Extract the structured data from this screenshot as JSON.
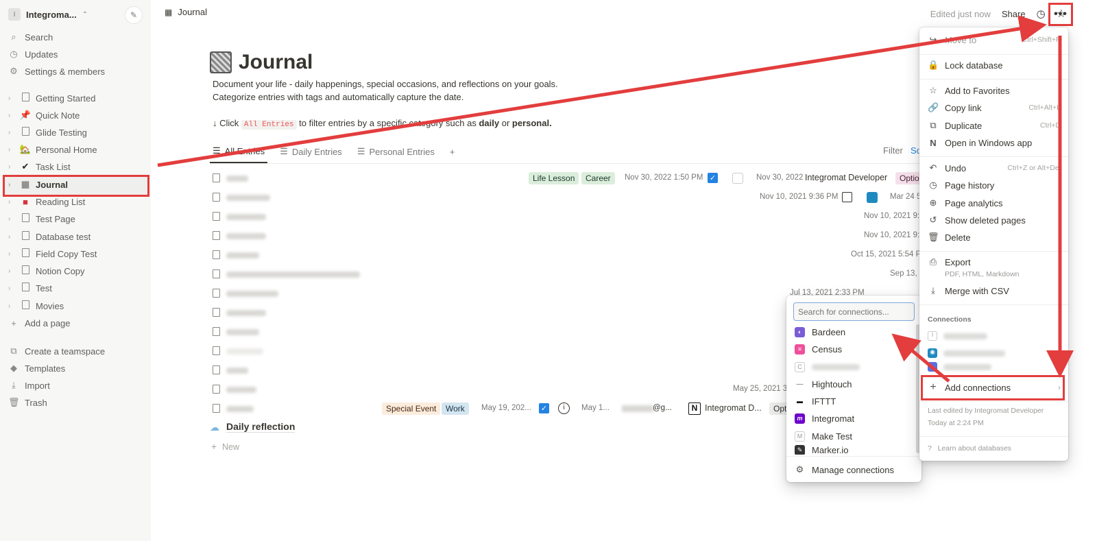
{
  "sidebar": {
    "workspace": "Integroma...",
    "workspace_initial": "I",
    "top": [
      "Search",
      "Updates",
      "Settings & members"
    ],
    "pages": [
      "Getting Started",
      "Quick Note",
      "Glide Testing",
      "Personal Home",
      "Task List",
      "Journal",
      "Reading List",
      "Test Page",
      "Database test",
      "Field Copy Test",
      "Notion Copy",
      "Test",
      "Movies"
    ],
    "add_page": "Add a page",
    "bottom": [
      "Create a teamspace",
      "Templates",
      "Import",
      "Trash"
    ]
  },
  "topbar": {
    "breadcrumb": "Journal",
    "edited": "Edited just now",
    "share": "Share"
  },
  "page": {
    "title": "Journal",
    "desc1": "Document your life - daily happenings, special occasions, and reflections on your goals.",
    "desc2": "Categorize entries with tags and automatically capture the date.",
    "tip_pre": "↓ Click",
    "tip_code": "All Entries",
    "tip_mid": "to filter entries by a specific category such as",
    "tip_b1": "daily",
    "tip_or": "or",
    "tip_b2": "personal.",
    "tabs": [
      "All Entries",
      "Daily Entries",
      "Personal Entries"
    ],
    "filter": "Filter",
    "sort": "So",
    "rows": {
      "r1": {
        "tag1": "Life Lesson",
        "tag2": "Career",
        "created": "Nov 30, 2022 1:50 PM",
        "date": "Nov 30, 2022",
        "person": "Integromat Developer",
        "opt": "Optio"
      },
      "r2": {
        "created": "Nov 10, 2021 9:36 PM",
        "date": "Mar 24 5"
      },
      "r3": {
        "created": "Nov 10, 2021 9:3"
      },
      "r4": {
        "created": "Nov 10, 2021 9:3"
      },
      "r5": {
        "created": "Oct 15, 2021 5:54 PM"
      },
      "r6": {
        "created": "Sep 13, 2"
      },
      "r7": {
        "created": "Jul 13, 2021 2:33 PM"
      },
      "r12": {
        "created": "May 25, 2021 3:3"
      },
      "r13": {
        "tag1": "Special Event",
        "tag2": "Work",
        "created": "May 19, 202...",
        "date": "May 1...",
        "email": "@g...",
        "person": "Integromat D...",
        "opt": "Opt"
      }
    },
    "daily": "Daily reflection",
    "new": "New"
  },
  "menu": {
    "move": "Move to",
    "move_sc": "Ctrl+Shift+P",
    "lock": "Lock database",
    "fav": "Add to Favorites",
    "copy": "Copy link",
    "copy_sc": "Ctrl+Alt+L",
    "dup": "Duplicate",
    "dup_sc": "Ctrl+D",
    "open": "Open in Windows app",
    "undo": "Undo",
    "undo_sc": "Ctrl+Z or Alt+Del",
    "history": "Page history",
    "analytics": "Page analytics",
    "deleted": "Show deleted pages",
    "delete": "Delete",
    "export": "Export",
    "export_sub": "PDF, HTML, Markdown",
    "merge": "Merge with CSV",
    "connections": "Connections",
    "add": "Add connections",
    "last1": "Last edited by Integromat Developer",
    "last2": "Today at 2:24 PM",
    "learn": "Learn about databases"
  },
  "connections_panel": {
    "placeholder": "Search for connections...",
    "items": [
      "Bardeen",
      "Census",
      "Hightouch",
      "IFTTT",
      "Integromat",
      "Make Test",
      "Marker.io"
    ],
    "manage": "Manage connections"
  },
  "colors": {
    "accent": "#2383e2",
    "highlight": "#e33d3d"
  }
}
